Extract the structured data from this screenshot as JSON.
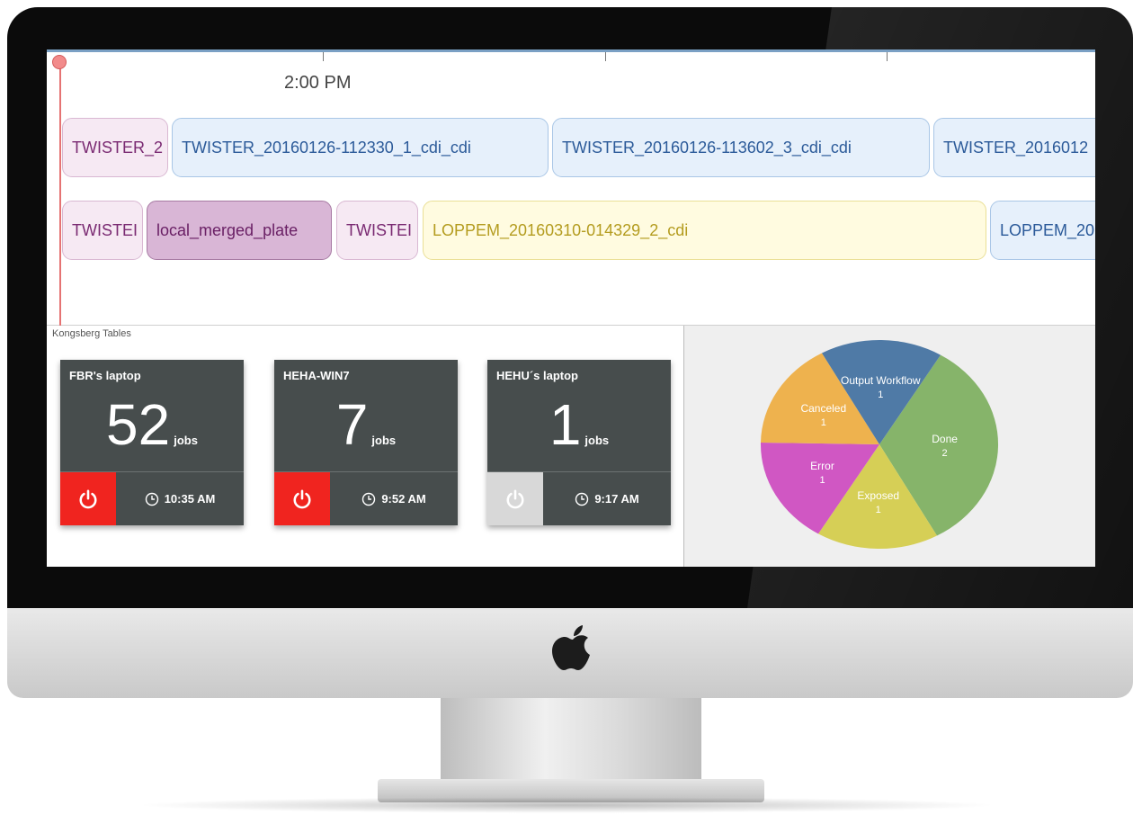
{
  "timeline": {
    "time_label": "2:00 PM",
    "row1": [
      {
        "label": "TWISTER_2"
      },
      {
        "label": "TWISTER_20160126-112330_1_cdi_cdi"
      },
      {
        "label": "TWISTER_20160126-113602_3_cdi_cdi"
      },
      {
        "label": "TWISTER_2016012"
      }
    ],
    "row2": [
      {
        "label": "TWISTEI"
      },
      {
        "label": "local_merged_plate"
      },
      {
        "label": "TWISTEI"
      },
      {
        "label": "LOPPEM_20160310-014329_2_cdi"
      },
      {
        "label": "LOPPEM_20"
      }
    ]
  },
  "section_title": "Kongsberg Tables",
  "tables": [
    {
      "name": "FBR's laptop",
      "count": "52",
      "unit": "jobs",
      "time": "10:35 AM",
      "power_state": "on",
      "power_icon": "power-icon",
      "clock_icon": "clock-icon"
    },
    {
      "name": "HEHA-WIN7",
      "count": "7",
      "unit": "jobs",
      "time": "9:52 AM",
      "power_state": "on",
      "power_icon": "power-icon",
      "clock_icon": "clock-icon"
    },
    {
      "name": "HEHU´s laptop",
      "count": "1",
      "unit": "jobs",
      "time": "9:17 AM",
      "power_state": "off",
      "power_icon": "power-icon",
      "clock_icon": "clock-icon"
    }
  ],
  "colors": {
    "power_on": "#f0241f",
    "power_off": "#d8d8d8",
    "card_bg": "#474d4d"
  },
  "chart_data": {
    "type": "pie",
    "slices": [
      {
        "label": "Done",
        "value": 2,
        "color": "#86b46a"
      },
      {
        "label": "Exposed",
        "value": 1,
        "color": "#d6cf56"
      },
      {
        "label": "Error",
        "value": 1,
        "color": "#d057c3"
      },
      {
        "label": "Canceled",
        "value": 1,
        "color": "#eeb24e"
      },
      {
        "label": "Output Workflow",
        "value": 1,
        "color": "#4f7aa6"
      }
    ]
  }
}
